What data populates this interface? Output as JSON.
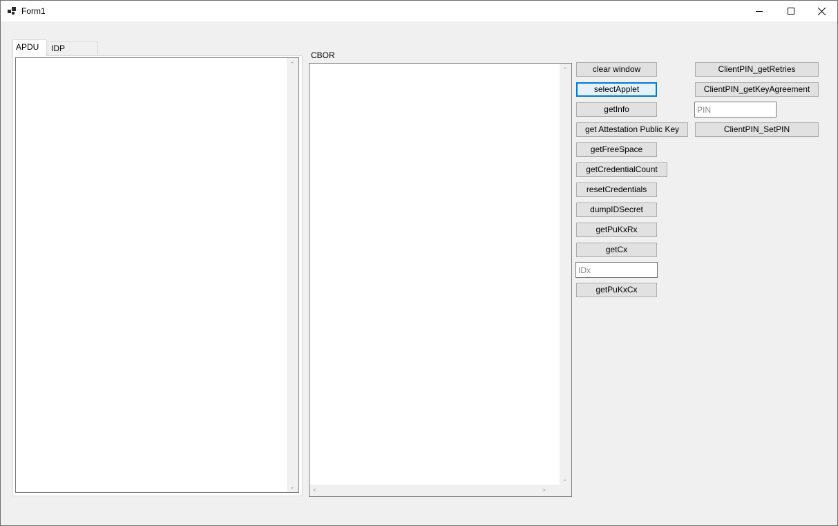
{
  "window": {
    "title": "Form1"
  },
  "caption_buttons": {
    "minimize_icon": "minimize-icon",
    "maximize_icon": "maximize-icon",
    "close_icon": "close-icon"
  },
  "tabs": [
    {
      "label": "APDU",
      "active": true
    },
    {
      "label": "IDP params",
      "active": false
    }
  ],
  "cbor": {
    "label": "CBOR"
  },
  "buttons_left": [
    "clear window",
    "selectApplet",
    "getInfo",
    "get Attestation Public Key",
    "getFreeSpace",
    "getCredentialCount",
    "resetCredentials",
    "dumpIDSecret",
    "getPuKxRx",
    "getCx",
    "getPuKxCx"
  ],
  "idx_input": {
    "value": "",
    "placeholder": "IDx"
  },
  "buttons_right": [
    "ClientPIN_getRetries",
    "ClientPIN_getKeyAgreement",
    "ClientPIN_SetPIN"
  ],
  "pin_input": {
    "value": "",
    "placeholder": "PIN"
  },
  "colors": {
    "background": "#f0f0f0",
    "button": "#e1e1e1",
    "focus_accent": "#0078d7"
  }
}
